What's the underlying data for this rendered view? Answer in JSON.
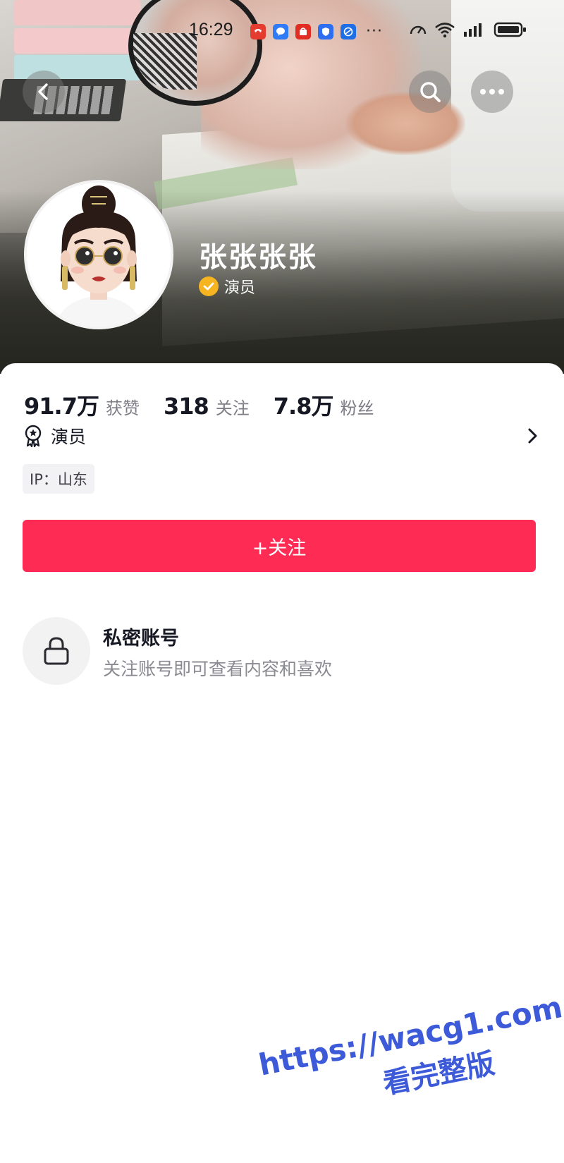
{
  "status_bar": {
    "time": "16:29",
    "overflow": "···"
  },
  "header": {
    "back_icon": "chevron-left-icon",
    "search_icon": "search-icon",
    "more_icon": "more-dots-icon"
  },
  "profile": {
    "nickname": "张张张张",
    "verified_label": "演员",
    "verified_color": "#f6b420"
  },
  "stats": [
    {
      "value": "91.7万",
      "label": "获赞"
    },
    {
      "value": "318",
      "label": "关注"
    },
    {
      "value": "7.8万",
      "label": "粉丝"
    }
  ],
  "role": {
    "label": "演员",
    "icon": "award-badge-icon"
  },
  "ip_tag": "IP：山东",
  "follow_button": {
    "label": "+关注",
    "color": "#fe2c55"
  },
  "private_account": {
    "title": "私密账号",
    "description": "关注账号即可查看内容和喜欢",
    "icon": "lock-icon"
  },
  "watermark": {
    "url": "https://wacg1.com",
    "text": "看完整版",
    "color": "#3d5bd9"
  }
}
